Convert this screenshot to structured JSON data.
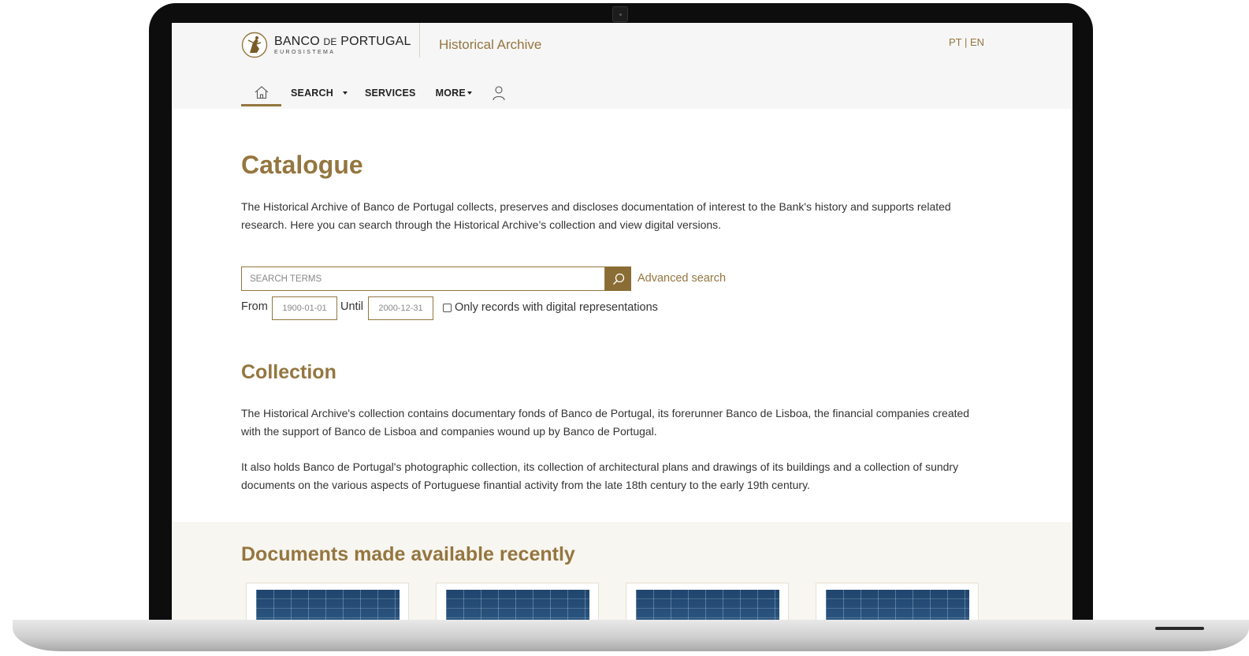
{
  "header": {
    "logo_name_part1": "BANCO ",
    "logo_name_small": "DE",
    "logo_name_part2": " PORTUGAL",
    "logo_sub": "EUROSISTEMA",
    "site_title": "Historical Archive",
    "language_switch": "PT | EN"
  },
  "nav": {
    "home_icon": "home-icon",
    "items": [
      {
        "label": "SEARCH"
      },
      {
        "label": "SERVICES"
      },
      {
        "label": "MORE"
      }
    ],
    "user_icon": "user-icon"
  },
  "catalogue": {
    "title": "Catalogue",
    "description": "The Historical Archive of Banco de Portugal collects, preserves and discloses documentation of interest to the Bank's history and supports related research. Here you can search through the Historical Archive’s collection and view digital versions.",
    "search": {
      "placeholder": "SEARCH TERMS",
      "value": "",
      "button_icon": "search-icon",
      "advanced_label": "Advanced search"
    },
    "from_label": "From",
    "from_placeholder": "1900-01-01",
    "until_label": "Until",
    "until_placeholder": "2000-12-31",
    "digital_only_label": "Only records with digital representations",
    "digital_only_checked": false
  },
  "collection": {
    "title": "Collection",
    "paragraph1": "The Historical Archive's collection contains documentary fonds of Banco de Portugal, its forerunner Banco de Lisboa, the financial companies created with the support of Banco de Lisboa and companies wound up by Banco de Portugal.",
    "paragraph2": "It also holds Banco de Portugal's photographic collection, its collection of architectural plans and drawings of its buildings and a collection of sundry documents on the various aspects of Portuguese finantial activity from the late 18th century to the early 19th century."
  },
  "recent": {
    "title": "Documents made available recently"
  },
  "colors": {
    "accent": "#94763f",
    "accent_dark": "#8a6d35",
    "text": "#333333",
    "header_bg": "#f6f6f6",
    "band_bg": "#f8f6f1"
  }
}
